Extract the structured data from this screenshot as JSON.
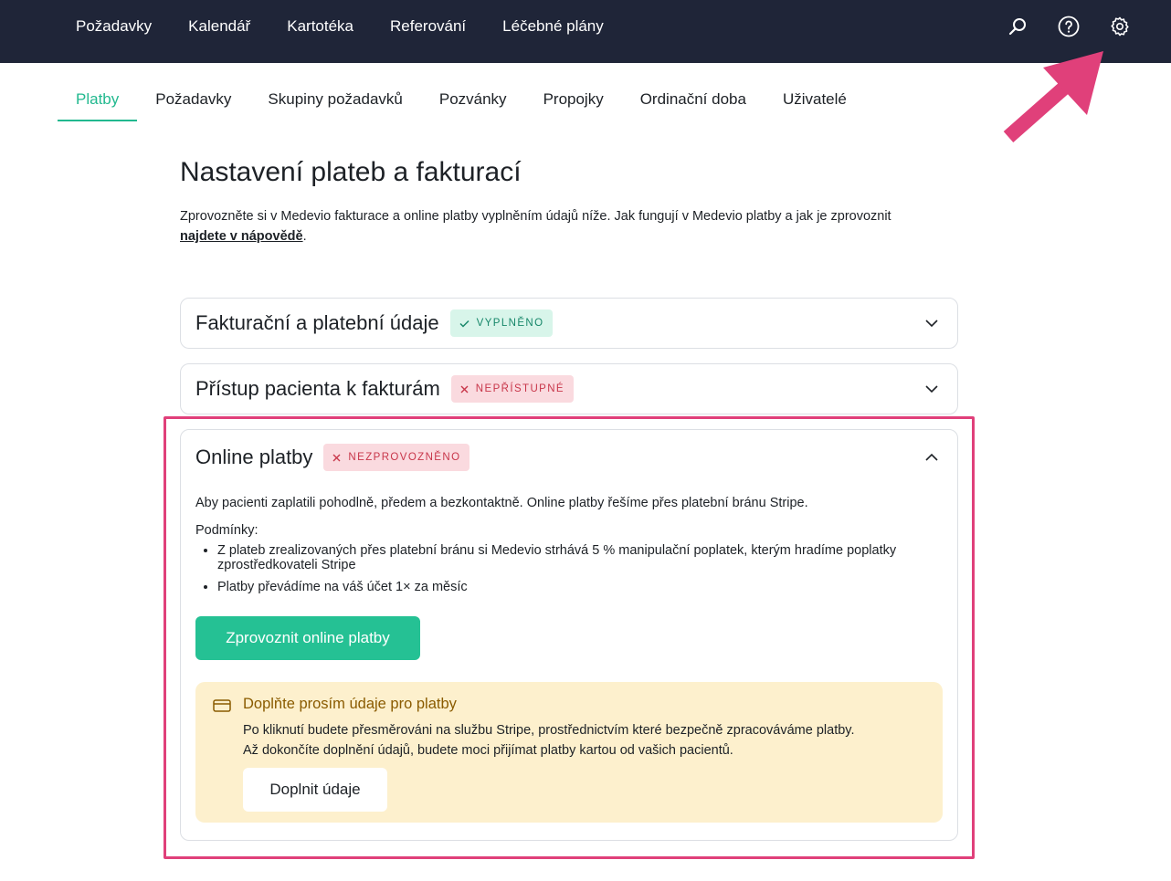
{
  "topnav": {
    "items": [
      "Požadavky",
      "Kalendář",
      "Kartotéka",
      "Referování",
      "Léčebné plány"
    ],
    "icons": [
      "search-icon",
      "help-icon",
      "settings-icon"
    ]
  },
  "tabs": {
    "items": [
      "Platby",
      "Požadavky",
      "Skupiny požadavků",
      "Pozvánky",
      "Propojky",
      "Ordinační doba",
      "Uživatelé"
    ],
    "active": "Platby"
  },
  "page": {
    "title": "Nastavení plateb a fakturací",
    "intro_text": "Zprovozněte si v Medevio fakturace a online platby vyplněním údajů níže. Jak fungují v Medevio platby a jak je zprovoznit ",
    "intro_link": "najdete v nápovědě",
    "intro_end": "."
  },
  "sections": {
    "billing": {
      "title": "Fakturační a platební údaje",
      "badge": "VYPLNĚNO"
    },
    "access": {
      "title": "Přístup pacienta k fakturám",
      "badge": "NEPŘÍSTUPNÉ"
    },
    "online": {
      "title": "Online platby",
      "badge": "NEZPROVOZNĚNO",
      "description": "Aby pacienti zaplatili pohodlně, předem a bezkontaktně. Online platby řešíme přes platební bránu Stripe.",
      "conditions_label": "Podmínky:",
      "conditions": [
        "Z plateb zrealizovaných přes platební bránu si Medevio strhává 5 % manipulační poplatek, kterým hradíme poplatky zprostředkovateli Stripe",
        "Platby převádíme na váš účet 1× za měsíc"
      ],
      "enable_button": "Zprovoznit online platby",
      "notice": {
        "title": "Doplňte prosím údaje pro platby",
        "text1": "Po kliknutí budete přesměrováni na službu Stripe, prostřednictvím které bezpečně zpracováváme platby.",
        "text2": "Až dokončíte doplnění údajů, budete moci přijímat platby kartou od vašich pacientů.",
        "button": "Doplnit údaje"
      }
    }
  },
  "colors": {
    "topbar": "#1f2538",
    "accent": "#22b98f",
    "annotation": "#e0407a",
    "success_badge": "#d8f5ea",
    "error_badge": "#fadadf",
    "notice_bg": "#fdf0cd"
  }
}
